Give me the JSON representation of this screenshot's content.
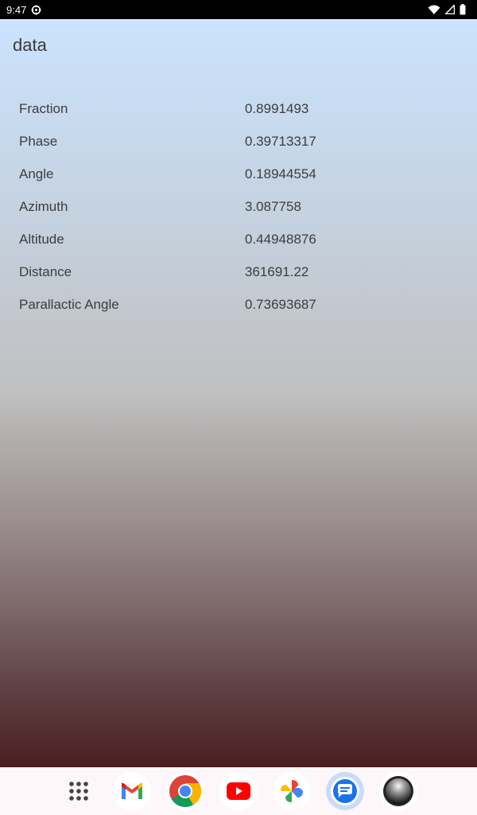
{
  "status_bar": {
    "time": "9:47"
  },
  "app": {
    "title": "data"
  },
  "rows": [
    {
      "label": "Fraction",
      "value": "0.8991493"
    },
    {
      "label": "Phase",
      "value": "0.39713317"
    },
    {
      "label": "Angle",
      "value": "0.18944554"
    },
    {
      "label": "Azimuth",
      "value": "3.087758"
    },
    {
      "label": "Altitude",
      "value": "0.44948876"
    },
    {
      "label": "Distance",
      "value": "361691.22"
    },
    {
      "label": "Parallactic Angle",
      "value": "0.73693687"
    }
  ],
  "taskbar": {
    "icons": [
      "app-drawer-icon",
      "gmail-icon",
      "chrome-icon",
      "youtube-icon",
      "photos-icon",
      "messages-icon",
      "camera-icon"
    ]
  },
  "colors": {
    "status_bar_bg": "#000000",
    "gradient_top": "#cbe3fd",
    "gradient_bottom": "#4a1f21",
    "taskbar_bg": "#fdf7fa"
  }
}
